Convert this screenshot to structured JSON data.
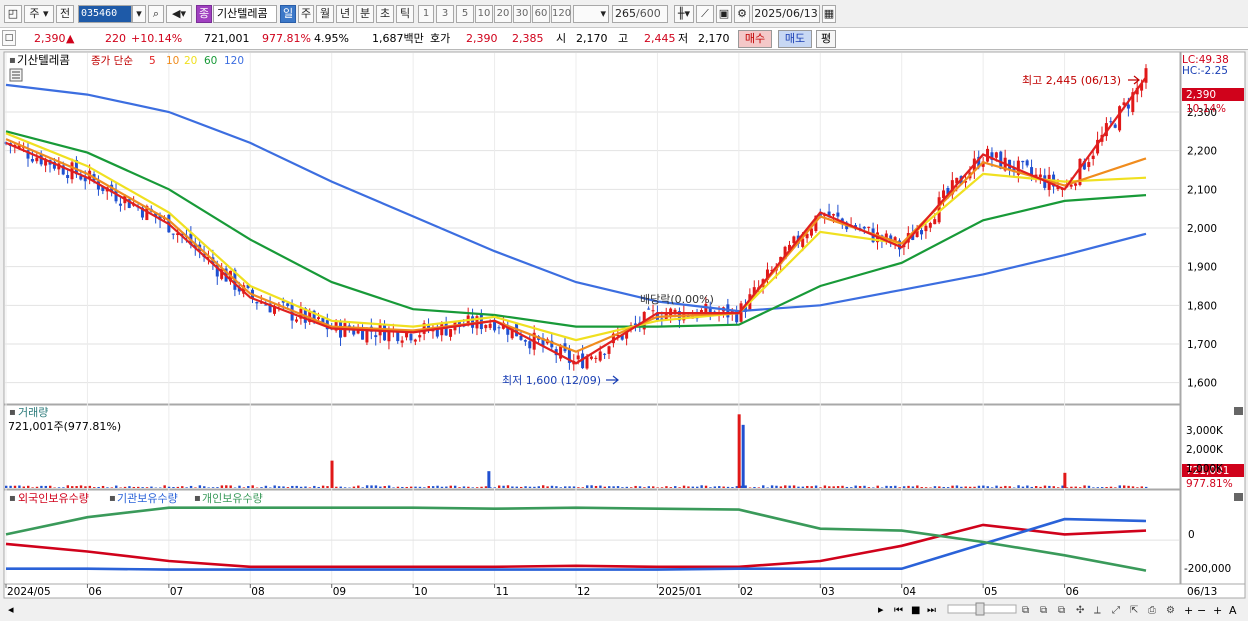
{
  "toolbar": {
    "market": "주",
    "prev": "전",
    "code": "035460",
    "badge": "종",
    "name": "기산텔레콤",
    "periods": [
      "일",
      "주",
      "월",
      "년",
      "분",
      "초",
      "틱"
    ],
    "selected_period": "일",
    "intervals": [
      "1",
      "3",
      "5",
      "10",
      "20",
      "30",
      "60",
      "120"
    ],
    "count": "265",
    "count_max": "/600",
    "date": "2025/06/13"
  },
  "quote": {
    "price": "2,390",
    "arrow": "▲",
    "change": "220",
    "change_pct": "+10.14%",
    "volume": "721,001",
    "volume_ratio": "977.81%",
    "turnover_rate": "4.95%",
    "value": "1,687백만",
    "ask_label": "호가",
    "ask": "2,390",
    "bid": "2,385",
    "open_label": "시",
    "open": "2,170",
    "high_label": "고",
    "high": "2,445",
    "low_label": "저",
    "low": "2,170",
    "buy_label": "매수",
    "sell_label": "매도",
    "eval_label": "평"
  },
  "price_panel": {
    "name": "기산텔레콤",
    "legend_label": "종가 단순",
    "ma_labels": [
      {
        "label": "5",
        "color": "#e02020"
      },
      {
        "label": "10",
        "color": "#f08c1e"
      },
      {
        "label": "20",
        "color": "#f0e020"
      },
      {
        "label": "60",
        "color": "#189a38"
      },
      {
        "label": "120",
        "color": "#3c6ee0"
      }
    ],
    "lc": "LC:49.38",
    "hc": "HC:-2.25",
    "last_price_tag": "2,390",
    "last_pct_tag": "10.14%",
    "high_annotation": "최고 2,445 (06/13)",
    "low_annotation": "최저 1,600 (12/09)",
    "event_annotation": "배당락(0.00%)",
    "y_ticks": [
      "2,300",
      "2,200",
      "2,100",
      "2,000",
      "1,900",
      "1,800",
      "1,700",
      "1,600"
    ]
  },
  "volume_panel": {
    "title": "거래량",
    "value": "721,001주(977.81%)",
    "y_ticks": [
      "3,000K",
      "2,000K",
      "1,000K"
    ],
    "last_tag": "721,001",
    "last_pct_tag": "977.81%"
  },
  "holdings_panel": {
    "legend": [
      {
        "label": "외국인보유수량",
        "color": "#d0021b"
      },
      {
        "label": "기관보유수량",
        "color": "#2a62d8"
      },
      {
        "label": "개인보유수량",
        "color": "#3a9a5a"
      }
    ],
    "y_ticks": [
      "0",
      "-200,000"
    ]
  },
  "x_axis": {
    "labels": [
      "2024/05",
      "06",
      "07",
      "08",
      "09",
      "10",
      "11",
      "12",
      "2025/01",
      "02",
      "03",
      "04",
      "05",
      "06"
    ],
    "last_label": "06/13"
  },
  "chart_data": {
    "type": "candlestick",
    "x_range": [
      "2024-05",
      "2025-06-13"
    ],
    "price_ylim": [
      1550,
      2450
    ],
    "series": [
      {
        "name": "5",
        "x": [
          "2024/05",
          "06",
          "07",
          "08",
          "09",
          "10",
          "11",
          "12",
          "2025/01",
          "02",
          "03",
          "04",
          "05",
          "06",
          "06/13"
        ],
        "values": [
          2220,
          2130,
          2010,
          1820,
          1740,
          1730,
          1760,
          1650,
          1780,
          1780,
          2040,
          1950,
          2190,
          2100,
          2390
        ]
      },
      {
        "name": "10",
        "x": [
          "2024/05",
          "06",
          "07",
          "08",
          "09",
          "10",
          "11",
          "12",
          "2025/01",
          "02",
          "03",
          "04",
          "05",
          "06",
          "06/13"
        ],
        "values": [
          2230,
          2140,
          2020,
          1830,
          1745,
          1735,
          1760,
          1680,
          1770,
          1780,
          2030,
          1960,
          2170,
          2110,
          2180
        ]
      },
      {
        "name": "20",
        "x": [
          "2024/05",
          "06",
          "07",
          "08",
          "09",
          "10",
          "11",
          "12",
          "2025/01",
          "02",
          "03",
          "04",
          "05",
          "06",
          "06/13"
        ],
        "values": [
          2245,
          2160,
          2040,
          1850,
          1760,
          1745,
          1770,
          1710,
          1760,
          1780,
          1990,
          1960,
          2140,
          2120,
          2130
        ]
      },
      {
        "name": "60",
        "x": [
          "2024/05",
          "06",
          "07",
          "08",
          "09",
          "10",
          "11",
          "12",
          "2025/01",
          "02",
          "03",
          "04",
          "05",
          "06",
          "06/13"
        ],
        "values": [
          2250,
          2195,
          2100,
          1970,
          1860,
          1790,
          1775,
          1745,
          1745,
          1750,
          1850,
          1910,
          2020,
          2070,
          2085
        ]
      },
      {
        "name": "120",
        "x": [
          "2024/05",
          "06",
          "07",
          "08",
          "09",
          "10",
          "11",
          "12",
          "2025/01",
          "02",
          "03",
          "04",
          "05",
          "06",
          "06/13"
        ],
        "values": [
          2370,
          2345,
          2300,
          2220,
          2120,
          2030,
          1940,
          1860,
          1810,
          1785,
          1800,
          1840,
          1880,
          1930,
          1985
        ]
      }
    ],
    "volume_spikes_k": [
      {
        "x": "09",
        "value": 1300
      },
      {
        "x": "11",
        "value": 800
      },
      {
        "x": "02",
        "value": 3500
      },
      {
        "x": "02",
        "value": 3000
      },
      {
        "x": "06/13",
        "value": 721
      }
    ],
    "holdings": [
      {
        "name": "외국인보유수량",
        "x": [
          "2024/05",
          "06",
          "07",
          "08",
          "09",
          "10",
          "11",
          "12",
          "2025/01",
          "02",
          "03",
          "04",
          "05",
          "06",
          "06/13"
        ],
        "values": [
          -20000,
          -60000,
          -110000,
          -140000,
          -140000,
          -140000,
          -140000,
          -135000,
          -140000,
          -140000,
          -110000,
          -30000,
          80000,
          30000,
          50000
        ]
      },
      {
        "name": "기관보유수량",
        "x": [
          "2024/05",
          "06",
          "07",
          "08",
          "09",
          "10",
          "11",
          "12",
          "2025/01",
          "02",
          "03",
          "04",
          "05",
          "06",
          "06/13"
        ],
        "values": [
          -150000,
          -150000,
          -155000,
          -155000,
          -155000,
          -155000,
          -155000,
          -155000,
          -155000,
          -150000,
          -150000,
          -150000,
          -20000,
          110000,
          100000
        ]
      },
      {
        "name": "개인보유수량",
        "x": [
          "2024/05",
          "06",
          "07",
          "08",
          "09",
          "10",
          "11",
          "12",
          "2025/01",
          "02",
          "03",
          "04",
          "05",
          "06",
          "06/13"
        ],
        "values": [
          30000,
          120000,
          170000,
          170000,
          170000,
          170000,
          165000,
          170000,
          165000,
          160000,
          60000,
          50000,
          -10000,
          -80000,
          -160000
        ]
      }
    ]
  }
}
